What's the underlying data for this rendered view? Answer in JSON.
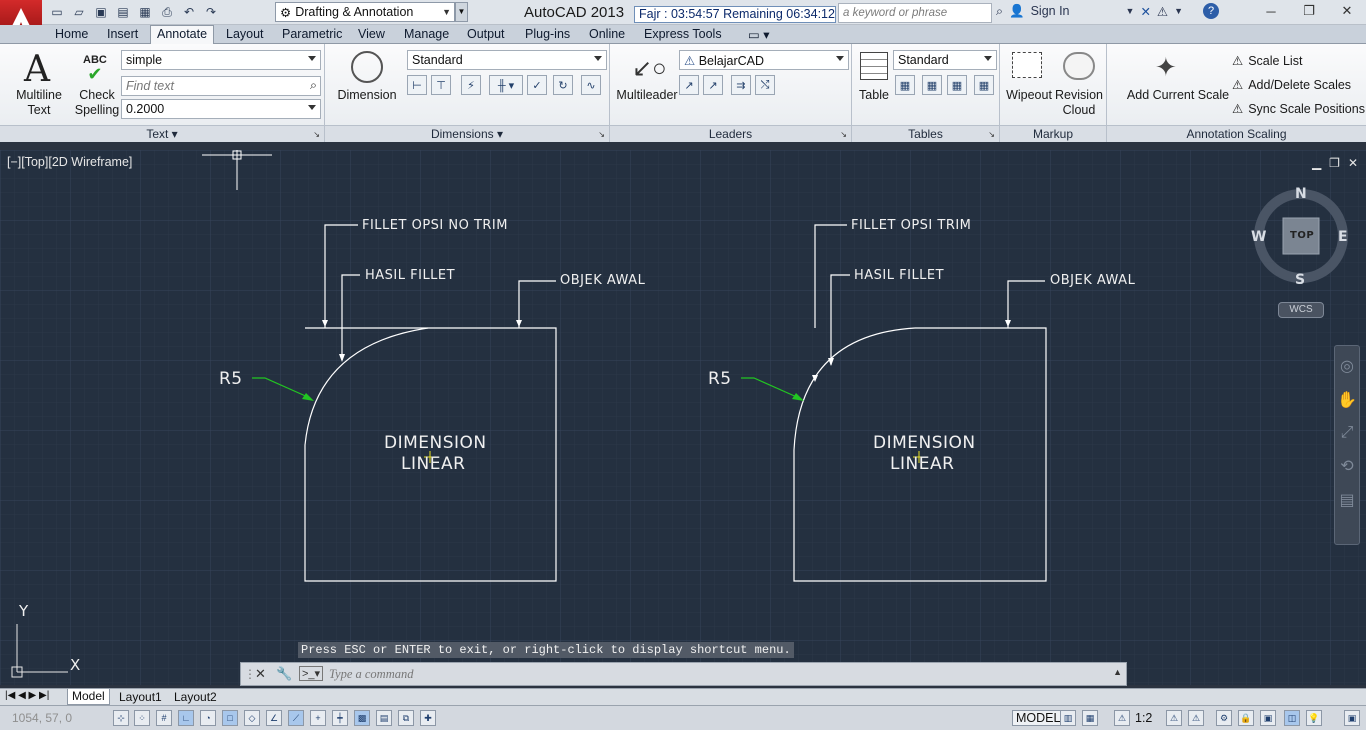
{
  "title_bar": {
    "app_title": "AutoCAD 2013",
    "workspace": "Drafting & Annotation",
    "prayer_timer": "Fajr : 03:54:57  Remaining 06:34:12",
    "search_placeholder": "a keyword or phrase",
    "sign_in": "Sign In"
  },
  "ribbon_tabs": [
    "Home",
    "Insert",
    "Annotate",
    "Layout",
    "Parametric",
    "View",
    "Manage",
    "Output",
    "Plug-ins",
    "Online",
    "Express Tools"
  ],
  "active_tab": "Annotate",
  "text_panel": {
    "multiline_label_1": "Multiline",
    "multiline_label_2": "Text",
    "check_label_1": "Check",
    "check_label_2": "Spelling",
    "check_abc": "ABC",
    "text_style": "simple",
    "find_placeholder": "Find text",
    "text_height": "0.2000",
    "title": "Text"
  },
  "dimensions_panel": {
    "dimension_label": "Dimension",
    "dim_style": "Standard",
    "title": "Dimensions"
  },
  "leaders_panel": {
    "multileader_label": "Multileader",
    "leader_style": "BelajarCAD",
    "title": "Leaders"
  },
  "tables_panel": {
    "table_label": "Table",
    "table_style": "Standard",
    "title": "Tables"
  },
  "markup_panel": {
    "wipeout_label": "Wipeout",
    "revision_label_1": "Revision",
    "revision_label_2": "Cloud",
    "title": "Markup"
  },
  "scaling_panel": {
    "add_current_scale": "Add Current Scale",
    "scale_list": "Scale List",
    "add_delete_scales": "Add/Delete Scales",
    "sync_scale_positions": "Sync Scale Positions",
    "title": "Annotation Scaling"
  },
  "viewport": {
    "label": "[−][Top][2D Wireframe]",
    "compass": {
      "n": "N",
      "s": "S",
      "e": "E",
      "w": "W",
      "top": "TOP"
    },
    "wcs": "WCS",
    "ucs_x": "X",
    "ucs_y": "Y"
  },
  "drawing": {
    "left": {
      "fillet_title": "FILLET OPSI NO TRIM",
      "hasil_fillet": "HASIL FILLET",
      "objek_awal": "OBJEK AWAL",
      "radius": "R5",
      "center_line1": "DIMENSION",
      "center_line2": "LINEAR"
    },
    "right": {
      "fillet_title": "FILLET OPSI TRIM",
      "hasil_fillet": "HASIL FILLET",
      "objek_awal": "OBJEK AWAL",
      "radius": "R5",
      "center_line1": "DIMENSION",
      "center_line2": "LINEAR"
    }
  },
  "command": {
    "message": "Press ESC or ENTER to exit, or right-click to display shortcut menu.",
    "placeholder": "Type a command"
  },
  "layout_tabs": [
    "Model",
    "Layout1",
    "Layout2"
  ],
  "status_bar": {
    "coords": "1054, 57, 0",
    "model": "MODEL",
    "annotation_scale": "1:2"
  },
  "colors": {
    "canvas": "#243040",
    "leader_green": "#22c522",
    "cursor_yellow": "#e8e020",
    "title_red": "#c21f1f"
  }
}
